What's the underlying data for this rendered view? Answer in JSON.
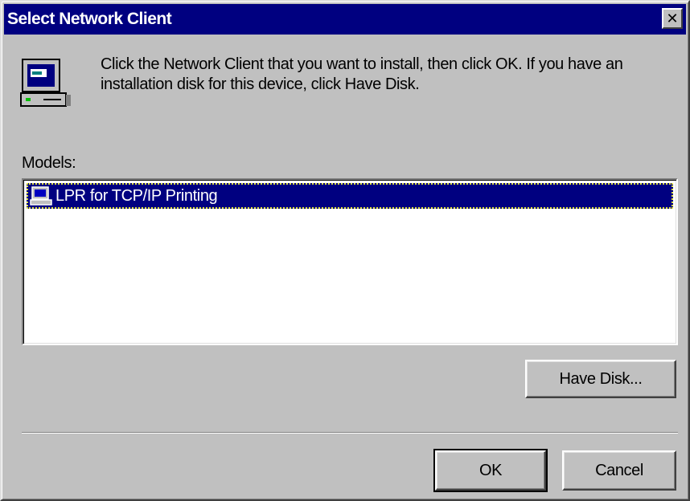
{
  "window": {
    "title": "Select Network Client",
    "close_glyph": "✕"
  },
  "instructions": "Click the Network Client that you want to install, then click OK. If you have an installation disk for this device, click Have Disk.",
  "models": {
    "label": "Models:",
    "items": [
      {
        "label": "LPR for TCP/IP Printing",
        "icon": "network-client-icon",
        "selected": true
      }
    ]
  },
  "buttons": {
    "have_disk": "Have Disk...",
    "ok": "OK",
    "cancel": "Cancel"
  },
  "colors": {
    "titlebar": "#000080",
    "dialog_face": "#c0c0c0",
    "selection": "#000080"
  }
}
